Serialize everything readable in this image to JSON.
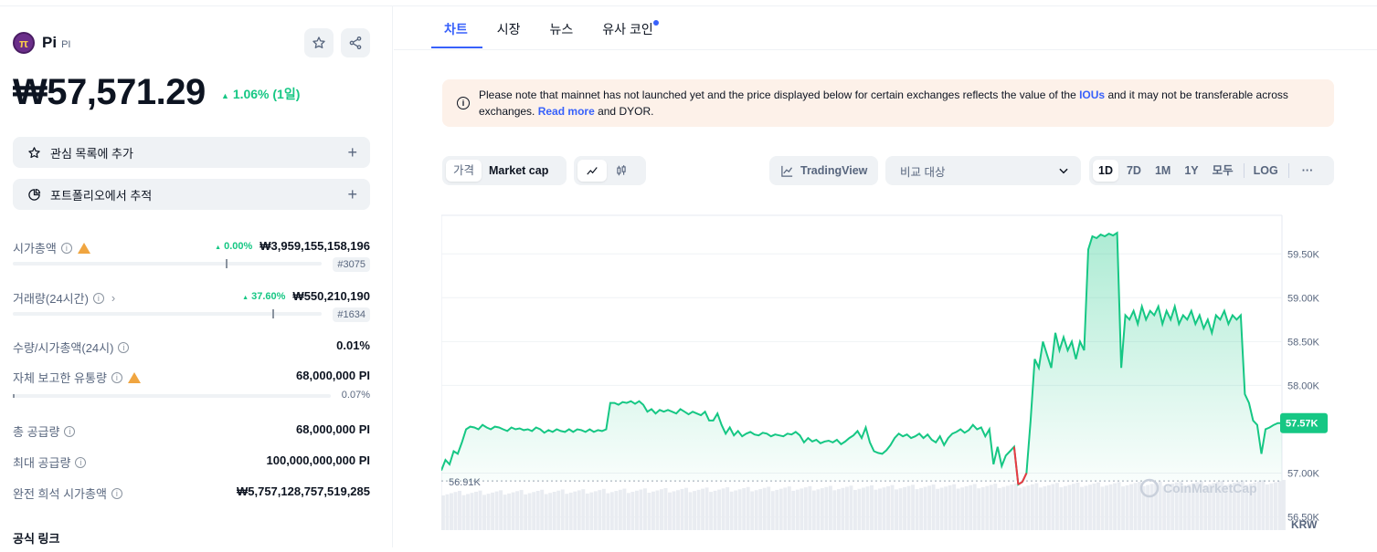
{
  "coin": {
    "name": "Pi",
    "symbol": "PI",
    "logo_glyph": "π",
    "price": "₩57,571.29",
    "change": "1.06% (1일)"
  },
  "actions": {
    "watchlist": "관심 목록에 추가",
    "portfolio": "포트폴리오에서 추적"
  },
  "stats": {
    "market_cap": {
      "label": "시가총액",
      "change": "0.00%",
      "value": "₩3,959,155,158,196",
      "rank": "#3075",
      "bar_level": 0.69
    },
    "volume": {
      "label": "거래량(24시간)",
      "change": "37.60%",
      "value": "₩550,210,190",
      "rank": "#1634",
      "bar_level": 0.84
    },
    "vol_mcap": {
      "label": "수량/시가총액(24시)",
      "value": "0.01%"
    },
    "self_supply": {
      "label": "자체 보고한 유통량",
      "value": "68,000,000 PI",
      "pct": "0.07%"
    },
    "total_supply": {
      "label": "총 공급량",
      "value": "68,000,000 PI"
    },
    "max_supply": {
      "label": "최대 공급량",
      "value": "100,000,000,000 PI"
    },
    "fdv": {
      "label": "완전 희석 시가총액",
      "value": "₩5,757,128,757,519,285"
    },
    "official_links": "공식 링크"
  },
  "tabs": [
    "차트",
    "시장",
    "뉴스",
    "유사 코인"
  ],
  "notice": {
    "text1": "Please note that mainnet has not launched yet and the price displayed below for certain exchanges reflects the value of the ",
    "link1": "IOUs",
    "text2": " and it may not be transferable across exchanges. ",
    "link2": "Read more",
    "text3": " and DYOR."
  },
  "controls": {
    "price_tab": "가격",
    "mcap_tab": "Market cap",
    "tradingview": "TradingView",
    "compare": "비교 대상",
    "ranges": [
      "1D",
      "7D",
      "1M",
      "1Y",
      "모두"
    ],
    "log": "LOG",
    "more": "···"
  },
  "colors": {
    "green": "#16c784",
    "red": "#ea3943",
    "accent": "#3861fb"
  },
  "chart_data": {
    "type": "area",
    "currency": "KRW",
    "watermark": "CoinMarketCap",
    "y_ticks": [
      "59.50K",
      "59.00K",
      "58.50K",
      "58.00K",
      "57.00K",
      "56.50K"
    ],
    "ylim": [
      56.35,
      59.95
    ],
    "open_value": 56.91,
    "open_label": "56.91K",
    "current_label": "57.57K",
    "series": [
      {
        "values": [
          57.03,
          57.15,
          57.1,
          57.25,
          57.22,
          57.35,
          57.5,
          57.53,
          57.52,
          57.5,
          57.55,
          57.52,
          57.5,
          57.53,
          57.52,
          57.5,
          57.48,
          57.52,
          57.5,
          57.51,
          57.49,
          57.5,
          57.48,
          57.52,
          57.5,
          57.46,
          57.49,
          57.47,
          57.5,
          57.48,
          57.47,
          57.5,
          57.47,
          57.5,
          57.49,
          57.47,
          57.5,
          57.47,
          57.49,
          57.48,
          57.5,
          57.8,
          57.8,
          57.78,
          57.81,
          57.8,
          57.82,
          57.79,
          57.82,
          57.78,
          57.7,
          57.73,
          57.68,
          57.72,
          57.7,
          57.72,
          57.7,
          57.68,
          57.73,
          57.7,
          57.67,
          57.7,
          57.68,
          57.66,
          57.7,
          57.6,
          57.6,
          57.68,
          57.55,
          57.45,
          57.52,
          57.43,
          57.48,
          57.42,
          57.45,
          57.47,
          57.44,
          57.43,
          57.46,
          57.45,
          57.42,
          57.44,
          57.43,
          57.42,
          57.45,
          57.44,
          57.47,
          57.43,
          57.35,
          57.4,
          57.36,
          57.38,
          57.34,
          57.36,
          57.37,
          57.35,
          57.38,
          57.33,
          57.36,
          57.4,
          57.43,
          57.48,
          57.4,
          57.52,
          57.35,
          57.25,
          57.23,
          57.22,
          57.26,
          57.32,
          57.4,
          57.45,
          57.42,
          57.44,
          57.4,
          57.42,
          57.45,
          57.4,
          57.44,
          57.38,
          57.35,
          57.42,
          57.32,
          57.4,
          57.45,
          57.47,
          57.5,
          57.46,
          57.49,
          57.55,
          57.5,
          57.52,
          57.42,
          57.5,
          57.1,
          57.3,
          57.08,
          57.2,
          57.25,
          57.3,
          56.87,
          56.9,
          57.0,
          57.6,
          58.3,
          58.2,
          58.5,
          58.35,
          58.2,
          58.6,
          58.4,
          58.55,
          58.4,
          58.5,
          58.3,
          58.5,
          58.4,
          59.55,
          59.7,
          59.68,
          59.72,
          59.7,
          59.73,
          59.71,
          59.74,
          58.2,
          58.8,
          58.75,
          58.85,
          58.7,
          58.9,
          58.75,
          58.85,
          58.8,
          58.9,
          58.7,
          58.85,
          58.75,
          58.9,
          58.7,
          58.8,
          58.75,
          58.85,
          58.7,
          58.8,
          58.65,
          58.75,
          58.6,
          58.8,
          58.75,
          58.85,
          58.7,
          58.8,
          58.75,
          58.8,
          57.9,
          57.8,
          57.6,
          57.55,
          57.22,
          57.5,
          57.52,
          57.55,
          57.57,
          57.57
        ]
      }
    ]
  }
}
